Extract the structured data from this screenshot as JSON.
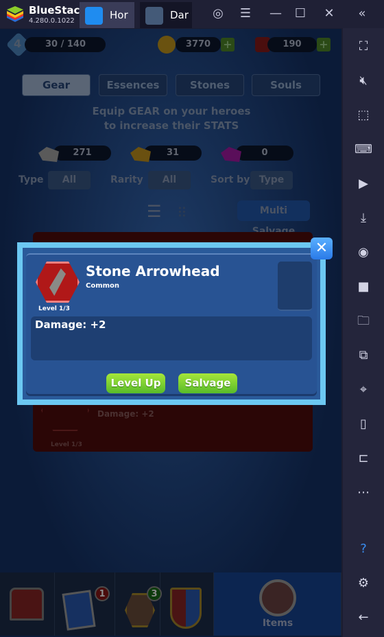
{
  "titlebar": {
    "app_name": "BlueStacks",
    "version": "4.280.0.1022",
    "tabs": [
      {
        "label": "Hor"
      },
      {
        "label": "Dar"
      }
    ]
  },
  "hud": {
    "level": "4",
    "xp": "30 / 140",
    "gold": "3770",
    "gems": "190"
  },
  "tabs": [
    {
      "label": "Gear",
      "active": true
    },
    {
      "label": "Essences"
    },
    {
      "label": "Stones"
    },
    {
      "label": "Souls"
    }
  ],
  "hint": {
    "line1": "Equip GEAR on your heroes",
    "line2": "to increase their STATS"
  },
  "resources": [
    {
      "value": "271",
      "color": "#8a8a8a"
    },
    {
      "value": "31",
      "color": "#b48a1a"
    },
    {
      "value": "0",
      "color": "#8a1a8a"
    }
  ],
  "filters": {
    "type_label": "Type",
    "type_value": "All",
    "rarity_label": "Rarity",
    "rarity_value": "All",
    "sort_label": "Sort by",
    "sort_value": "Type"
  },
  "multi_salvage": "Multi Salvage",
  "bg_card": {
    "stat": "Damage: +2",
    "level": "Level 1/3"
  },
  "modal": {
    "title": "Stone Arrowhead",
    "rarity": "Common",
    "level": "Level 1/3",
    "stat": "Damage: +2",
    "level_up": "Level Up",
    "salvage": "Salvage"
  },
  "nav": {
    "badge_cards": "1",
    "badge_heroes": "3",
    "items_label": "Items"
  },
  "colors": {
    "accent": "#6cc8f2",
    "button": "#7ed23a"
  }
}
